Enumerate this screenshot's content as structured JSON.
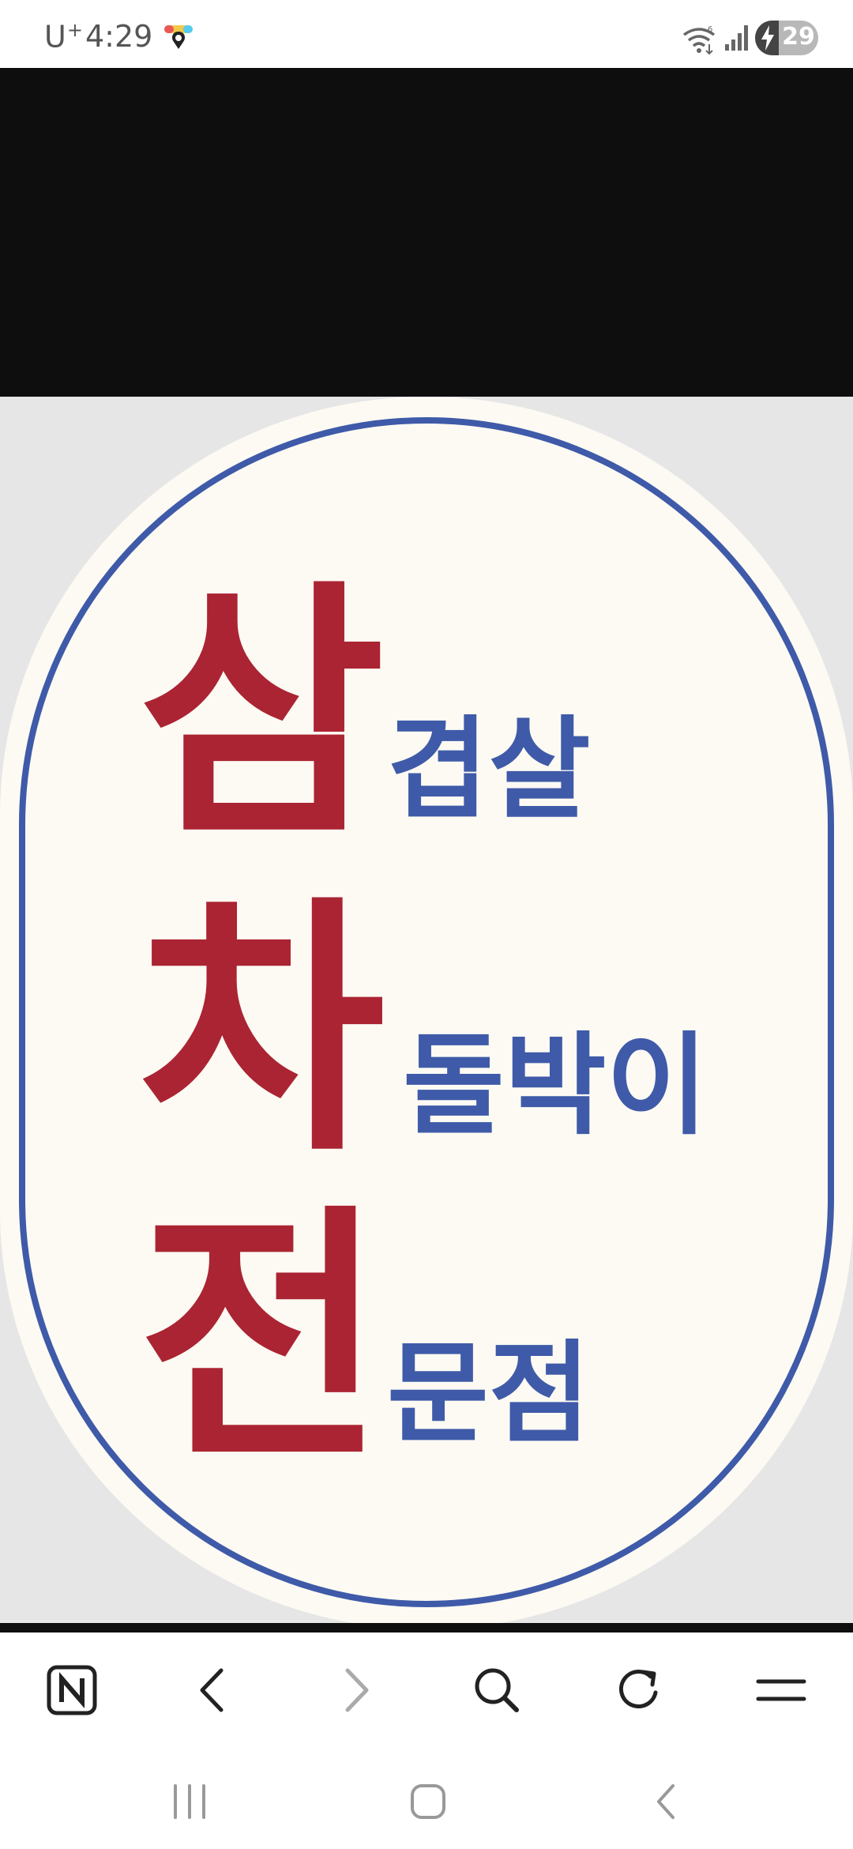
{
  "status_bar": {
    "carrier": "U",
    "carrier_sup": "+",
    "time": "4:29",
    "battery_level": "29",
    "icons": [
      "maps-icon",
      "wifi-icon",
      "signal-icon",
      "battery-icon"
    ]
  },
  "sign": {
    "line1_big": "삼",
    "line1_small": "겹살",
    "line2_big": "차",
    "line2_small": "돌박이",
    "line3_big": "전",
    "line3_small": "문점",
    "colors": {
      "red": "#ab2433",
      "blue": "#3f5aa8",
      "cream": "#fcfaf3",
      "backdrop": "#e6e6e6"
    }
  },
  "toolbar": {
    "icons": [
      "naver-home-icon",
      "back-arrow-icon",
      "forward-arrow-icon",
      "search-icon",
      "refresh-icon",
      "menu-icon"
    ]
  },
  "navbar": {
    "icons": [
      "recent-apps-icon",
      "home-icon",
      "back-icon"
    ]
  }
}
